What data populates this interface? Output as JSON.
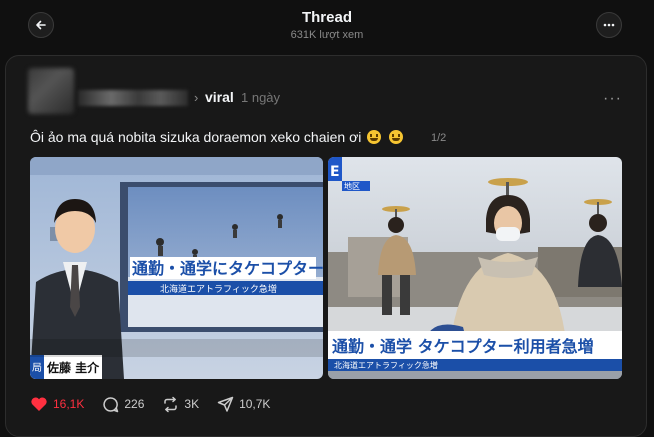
{
  "header": {
    "title": "Thread",
    "views": "631K lượt xem"
  },
  "post": {
    "community": "viral",
    "time": "1 ngày",
    "caption": "Ôi ảo ma quá nobita sizuka doraemon xeko chaien ơi",
    "pager": "1/2",
    "media": [
      {
        "banner": "通勤・通学にタケコプター",
        "sub": "北海道エアトラフィック急増",
        "name": "佐藤 圭介",
        "corner": "局"
      },
      {
        "banner": "通勤・通学 タケコプター利用者急増",
        "sub": "北海道エアトラフィック急増",
        "tag": "E",
        "region": "地区"
      }
    ],
    "stats": {
      "likes": "16,1K",
      "comments": "226",
      "reposts": "3K",
      "shares": "10,7K"
    }
  },
  "colors": {
    "background": "#101010",
    "card": "#181818",
    "like": "#ff3040"
  },
  "icons": [
    "back-arrow-icon",
    "more-icon",
    "heart-icon",
    "comment-icon",
    "repost-icon",
    "share-icon"
  ]
}
